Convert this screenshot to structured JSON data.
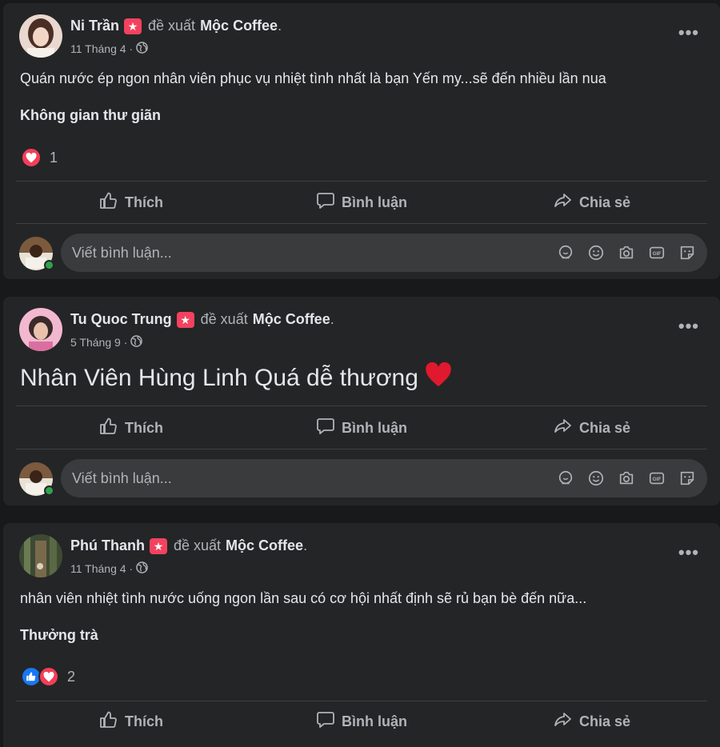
{
  "posts": [
    {
      "author": "Ni Trần",
      "verb": "đề xuất",
      "page": "Mộc Coffee",
      "period": ".",
      "date": "11 Tháng 4",
      "meta_sep": "·",
      "text": "Quán nước ép ngon nhân viên phục vụ nhiệt tình nhất là bạn Yến my...sẽ đến nhiều lần nua",
      "tag": "Không gian thư giãn",
      "reactions": [
        "heart"
      ],
      "reaction_count": "1"
    },
    {
      "author": "Tu Quoc Trung",
      "verb": "đề xuất",
      "page": "Mộc Coffee",
      "period": ".",
      "date": "5 Tháng 9",
      "meta_sep": "·",
      "text": "Nhân Viên Hùng Linh Quá dễ thương",
      "emoji": "heart-emoji"
    },
    {
      "author": "Phú Thanh",
      "verb": "đề xuất",
      "page": "Mộc Coffee",
      "period": ".",
      "date": "11 Tháng 4",
      "meta_sep": "·",
      "text": "nhân viên nhiệt tình nước uống ngon lần sau có cơ hội nhất định sẽ rủ bạn bè đến nữa...",
      "tag": "Thưởng trà",
      "reactions": [
        "like",
        "heart"
      ],
      "reaction_count": "2"
    }
  ],
  "actions": {
    "like": "Thích",
    "comment": "Bình luận",
    "share": "Chia sẻ"
  },
  "comment_box": {
    "placeholder": "Viết bình luận..."
  },
  "more_label": "•••",
  "colors": {
    "background": "#18191a",
    "card": "#242526",
    "input": "#3a3b3c",
    "text_primary": "#e4e6eb",
    "text_secondary": "#b0b3b8",
    "recommend_badge": "#f3425f",
    "heart": "#f33e58",
    "like": "#1877f2",
    "online": "#31a24c"
  }
}
